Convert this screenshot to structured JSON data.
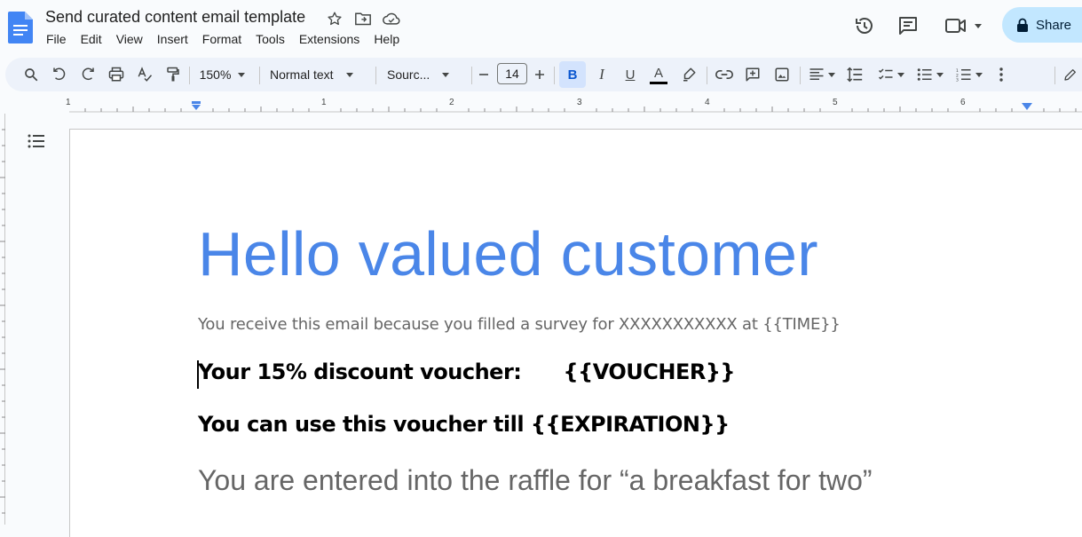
{
  "document": {
    "title": "Send curated content email template"
  },
  "menu": [
    "File",
    "Edit",
    "View",
    "Insert",
    "Format",
    "Tools",
    "Extensions",
    "Help"
  ],
  "header": {
    "share_label": "Share"
  },
  "toolbar": {
    "zoom": "150%",
    "style": "Normal text",
    "font": "Sourc...",
    "font_size": "14",
    "bold_label": "B",
    "italic_label": "I",
    "underline_label": "U",
    "text_color_label": "A"
  },
  "ruler": {
    "numbers": [
      "1",
      "1",
      "2",
      "3",
      "4",
      "5",
      "6"
    ]
  },
  "content": {
    "heading": "Hello valued customer",
    "subtitle": "You receive this email because you filled a survey for XXXXXXXXXXX  at {{TIME}}",
    "voucher_line": "Your 15% discount voucher:      {{VOUCHER}}",
    "expiration_line": "You can use this voucher till {{EXPIRATION}}",
    "raffle_line": "You are entered into the raffle for “a breakfast for two”"
  },
  "colors": {
    "heading": "#4a86e8",
    "subtitle": "#666666",
    "share_bg": "#c2e7ff",
    "toolbar_bg": "#edf2fa",
    "bold_active_bg": "#d3e3fd"
  }
}
